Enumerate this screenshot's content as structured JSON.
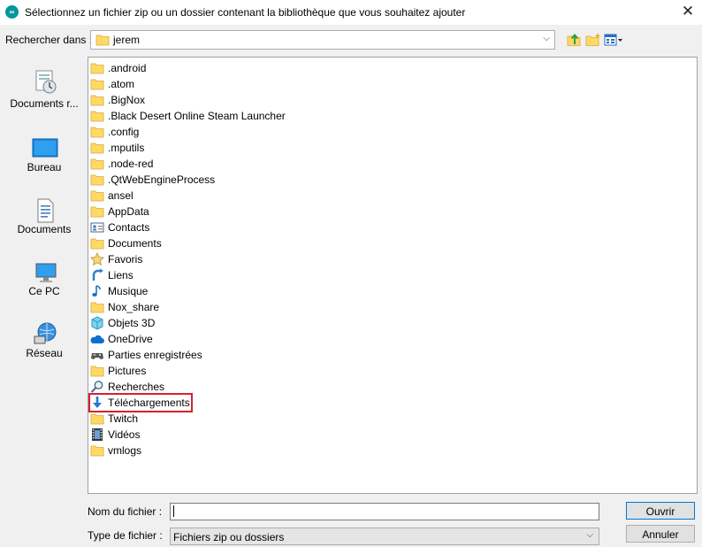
{
  "window": {
    "title": "Sélectionnez un fichier zip ou un dossier contenant la bibliothèque que vous souhaitez ajouter",
    "app_icon": "∞",
    "close": "✕"
  },
  "lookin": {
    "label": "Rechercher dans :",
    "value": "jerem",
    "chevron": "⌵"
  },
  "places": [
    {
      "label": "Documents r...",
      "icon": "recent-documents-icon"
    },
    {
      "label": "Bureau",
      "icon": "desktop-icon"
    },
    {
      "label": "Documents",
      "icon": "documents-icon"
    },
    {
      "label": "Ce PC",
      "icon": "computer-icon"
    },
    {
      "label": "Réseau",
      "icon": "network-icon"
    }
  ],
  "files": [
    {
      "name": ".android",
      "icon": "folder"
    },
    {
      "name": ".atom",
      "icon": "folder"
    },
    {
      "name": ".BigNox",
      "icon": "folder"
    },
    {
      "name": ".Black Desert Online Steam Launcher",
      "icon": "folder"
    },
    {
      "name": ".config",
      "icon": "folder"
    },
    {
      "name": ".mputils",
      "icon": "folder"
    },
    {
      "name": ".node-red",
      "icon": "folder"
    },
    {
      "name": ".QtWebEngineProcess",
      "icon": "folder"
    },
    {
      "name": "ansel",
      "icon": "folder"
    },
    {
      "name": "AppData",
      "icon": "folder"
    },
    {
      "name": "Contacts",
      "icon": "contacts"
    },
    {
      "name": "Documents",
      "icon": "folder"
    },
    {
      "name": "Favoris",
      "icon": "star"
    },
    {
      "name": "Liens",
      "icon": "link"
    },
    {
      "name": "Musique",
      "icon": "music"
    },
    {
      "name": "Nox_share",
      "icon": "folder"
    },
    {
      "name": "Objets 3D",
      "icon": "cube"
    },
    {
      "name": "OneDrive",
      "icon": "cloud"
    },
    {
      "name": "Parties enregistrées",
      "icon": "gamepad"
    },
    {
      "name": "Pictures",
      "icon": "folder"
    },
    {
      "name": "Recherches",
      "icon": "search"
    },
    {
      "name": "Téléchargements",
      "icon": "download",
      "highlighted": true
    },
    {
      "name": "Twitch",
      "icon": "folder"
    },
    {
      "name": "Vidéos",
      "icon": "film"
    },
    {
      "name": "vmlogs",
      "icon": "folder"
    }
  ],
  "filename": {
    "label": "Nom du fichier :",
    "value": ""
  },
  "filetype": {
    "label": "Type de fichier :",
    "value": "Fichiers zip ou dossiers",
    "chevron": "⌵"
  },
  "buttons": {
    "open": "Ouvrir",
    "cancel": "Annuler"
  },
  "colors": {
    "highlight": "#d9202f",
    "folder": "#ffd966",
    "accent": "#0078d7"
  }
}
